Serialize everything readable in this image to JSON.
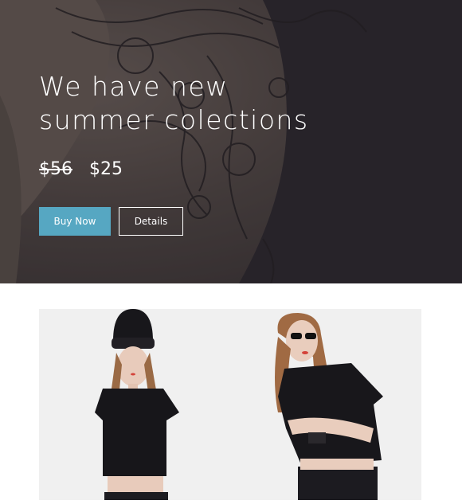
{
  "hero": {
    "title_line1": "We have new",
    "title_line2": "summer colections",
    "old_price": "$56",
    "new_price": "$25",
    "buy_label": "Buy Now",
    "details_label": "Details"
  },
  "colors": {
    "accent": "#56a7c2",
    "hero_overlay": "#3b3436",
    "panel_bg": "#f0f0f0"
  },
  "product": {
    "image_alt": "Two models wearing black crop tops"
  }
}
